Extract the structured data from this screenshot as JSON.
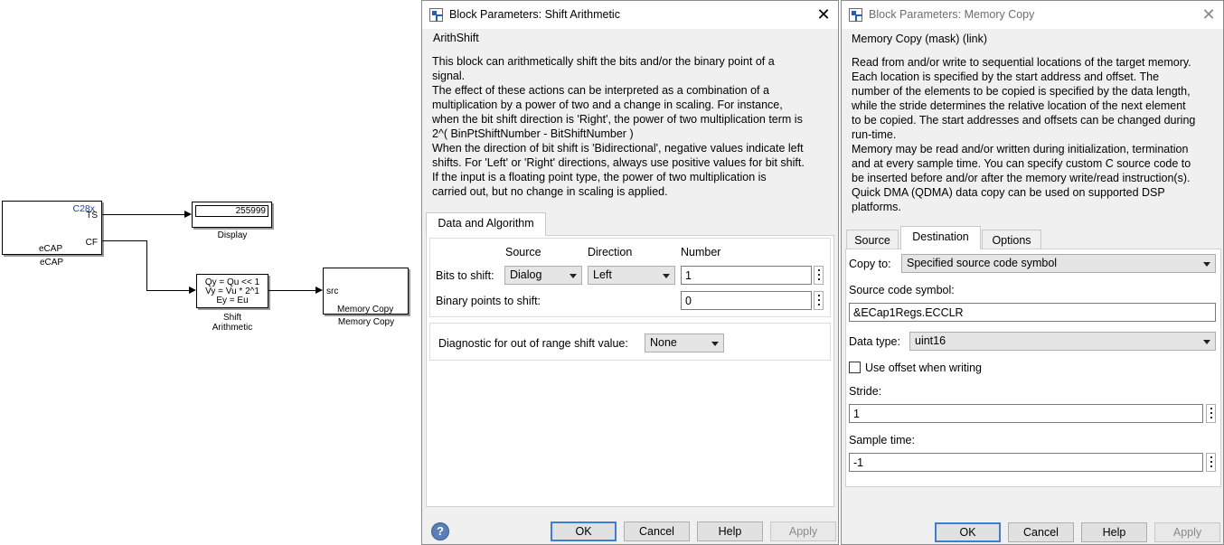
{
  "canvas": {
    "ecap": {
      "header": "C28x",
      "port_ts": "TS",
      "port_cf": "CF",
      "inner_label": "eCAP",
      "name": "eCAP"
    },
    "display": {
      "value": "255999",
      "name": "Display"
    },
    "shift": {
      "line1": "Qy = Qu << 1",
      "line2": "Vy = Vu * 2^1",
      "line3": "Ey = Eu",
      "name_line1": "Shift",
      "name_line2": "Arithmetic"
    },
    "memcopy": {
      "port_src": "src",
      "inner_label": "Memory Copy",
      "name": "Memory Copy"
    }
  },
  "shift_dialog": {
    "title": "Block Parameters: Shift Arithmetic",
    "section": "ArithShift",
    "description": "This block can arithmetically shift the bits and/or the binary point of a\nsignal.\nThe effect of these actions can be interpreted as a combination of a\nmultiplication by a power of two and a change in scaling.  For instance,\nwhen the bit shift direction is 'Right', the power of two multiplication term is\n    2^( BinPtShiftNumber - BitShiftNumber )\nWhen the direction of bit shift is 'Bidirectional', negative values indicate left\nshifts. For 'Left' or 'Right' directions, always use positive values for bit shift.\nIf the input is a floating point type, the power of two multiplication is\ncarried out, but no change in scaling is applied.",
    "tab_label": "Data and Algorithm",
    "col_source": "Source",
    "col_direction": "Direction",
    "col_number": "Number",
    "bits_label": "Bits to shift:",
    "bits_source": "Dialog",
    "bits_direction": "Left",
    "bits_number": "1",
    "binpt_label": "Binary points to shift:",
    "binpt_number": "0",
    "diag_label": "Diagnostic for out of range shift value:",
    "diag_value": "None",
    "buttons": {
      "ok": "OK",
      "cancel": "Cancel",
      "help": "Help",
      "apply": "Apply"
    },
    "help_icon": "?"
  },
  "memcopy_dialog": {
    "title": "Block Parameters: Memory Copy",
    "section": "Memory Copy (mask) (link)",
    "description": "Read from and/or write to sequential locations of the target memory.\nEach location is specified by the start address and offset. The\nnumber of the elements to be copied is specified by the data length,\nwhile the stride determines the relative location of the next element\nto be copied. The start addresses and offsets can be changed during\nrun-time.\nMemory may be read and/or written during initialization, termination\nand at every sample time. You can specify custom C source code to\nbe inserted before and/or after the memory write/read instruction(s).\nQuick DMA (QDMA) data copy can be used on supported DSP\nplatforms.",
    "tabs": [
      "Source",
      "Destination",
      "Options"
    ],
    "copy_to_label": "Copy to:",
    "copy_to_value": "Specified source code symbol",
    "symbol_label": "Source code symbol:",
    "symbol_value": "&ECap1Regs.ECCLR",
    "datatype_label": "Data type:",
    "datatype_value": "uint16",
    "offset_label": "Use offset when writing",
    "offset_checked": false,
    "stride_label": "Stride:",
    "stride_value": "1",
    "sample_label": "Sample time:",
    "sample_value": "-1",
    "buttons": {
      "ok": "OK",
      "cancel": "Cancel",
      "help": "Help",
      "apply": "Apply"
    }
  },
  "icons": {
    "close": "close-icon",
    "window": "simulink-window-icon",
    "help": "help-icon",
    "dropdown": "chevron-down-icon",
    "more": "more-options-icon"
  },
  "colors": {
    "dialog_bg": "#f0f0f0",
    "default_button_border": "#3c7fd1",
    "ecap_header": "#1f3fa0"
  }
}
